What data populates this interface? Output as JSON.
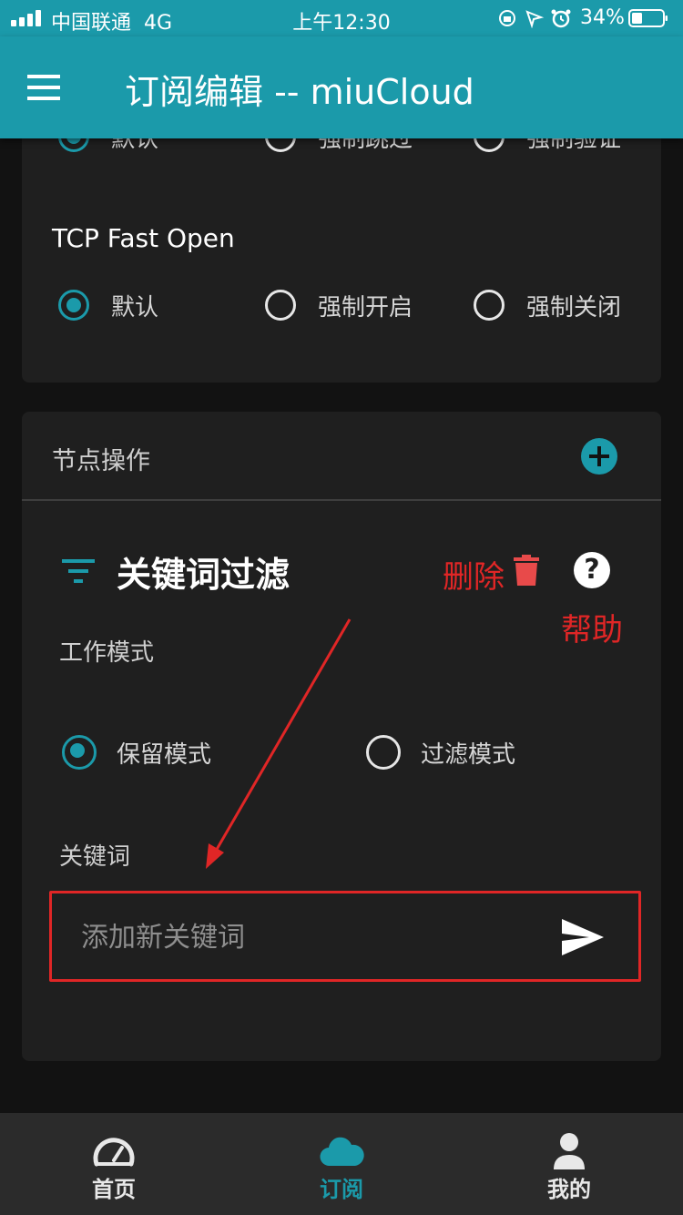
{
  "status_bar": {
    "carrier": "中国联通",
    "network": "4G",
    "time": "上午12:30",
    "battery": "34%"
  },
  "app_bar": {
    "title": "订阅编辑 -- miuCloud",
    "menu_icon": "hamburger-menu-icon"
  },
  "settings_card": {
    "partial_row": {
      "options": [
        "默认",
        "强制跳过",
        "强制验证"
      ],
      "selected_index": 0
    },
    "tcp_fast_open": {
      "title": "TCP Fast Open",
      "options": [
        "默认",
        "强制开启",
        "强制关闭"
      ],
      "selected_index": 0
    }
  },
  "node_ops_card": {
    "title": "节点操作",
    "add_icon": "plus-circle-icon",
    "filter": {
      "title": "关键词过滤",
      "icon": "filter-icon",
      "delete_icon": "trash-icon",
      "help_icon": "help-circle-icon",
      "mode_label": "工作模式",
      "modes": [
        "保留模式",
        "过滤模式"
      ],
      "selected_mode_index": 0,
      "keyword_label": "关键词",
      "keyword_placeholder": "添加新关键词",
      "keyword_value": "",
      "send_icon": "send-icon"
    }
  },
  "annotations": {
    "delete": "删除",
    "help": "帮助",
    "color": "#e02626"
  },
  "bottom_nav": {
    "tabs": [
      {
        "label": "首页",
        "icon": "speedometer-icon"
      },
      {
        "label": "订阅",
        "icon": "cloud-icon"
      },
      {
        "label": "我的",
        "icon": "person-icon"
      }
    ],
    "active_index": 1
  },
  "colors": {
    "accent": "#1b9aaa",
    "background": "#121212",
    "card": "#1f1f1f",
    "bottom_bar": "#2b2b2b",
    "annotation_red": "#e02626"
  }
}
